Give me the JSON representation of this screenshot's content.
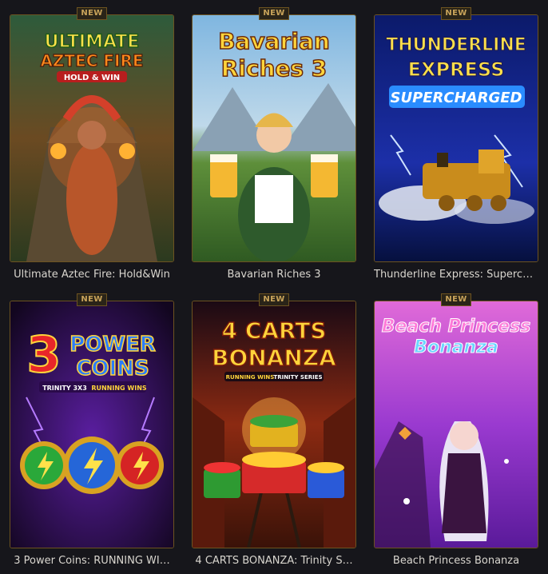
{
  "badge_label": "NEW",
  "games": [
    {
      "title": "Ultimate Aztec Fire: Hold&Win",
      "logo": [
        "ULTIMATE",
        "AZTEC FIRE",
        "HOLD & WIN"
      ]
    },
    {
      "title": "Bavarian Riches 3",
      "logo": [
        "Bavarian",
        "Riches 3"
      ]
    },
    {
      "title": "Thunderline Express: Superch…",
      "logo": [
        "THUNDERLINE",
        "EXPRESS",
        "SUPERCHARGED"
      ]
    },
    {
      "title": "3 Power Coins: RUNNING WI…",
      "logo": [
        "3",
        "POWER",
        "COINS",
        "TRINITY 3X3",
        "RUNNING WINS"
      ]
    },
    {
      "title": "4 CARTS BONANZA: Trinity S…",
      "logo": [
        "4 CARTS",
        "BONANZA",
        "RUNNING WINS",
        "TRINITY SERIES"
      ]
    },
    {
      "title": "Beach Princess Bonanza",
      "logo": [
        "Beach Princess",
        "Bonanza"
      ]
    }
  ]
}
